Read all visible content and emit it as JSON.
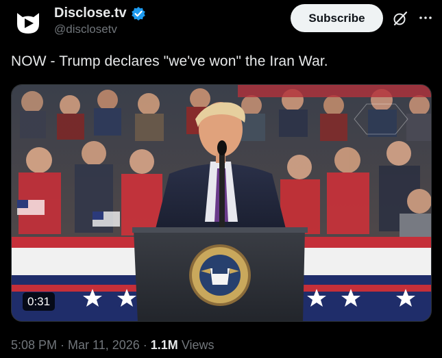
{
  "author": {
    "display_name": "Disclose.tv",
    "handle": "@disclosetv",
    "avatar_icon": "disclose-logo-icon",
    "verified_icon": "verified-badge-icon",
    "verified_color": "#1d9bf0"
  },
  "actions": {
    "subscribe_label": "Subscribe",
    "grok_icon": "grok-icon",
    "more_icon": "more-options-icon"
  },
  "post": {
    "text": "NOW - Trump declares \"we've won\" the Iran War.",
    "media": {
      "type": "video",
      "duration": "0:31",
      "description_icon": "video-thumbnail"
    }
  },
  "meta": {
    "time": "5:08 PM",
    "date": "Mar 11, 2026",
    "views_count": "1.1M",
    "views_label": "Views"
  },
  "colors": {
    "background": "#000000",
    "text_primary": "#e7e9ea",
    "text_secondary": "#71767b"
  }
}
